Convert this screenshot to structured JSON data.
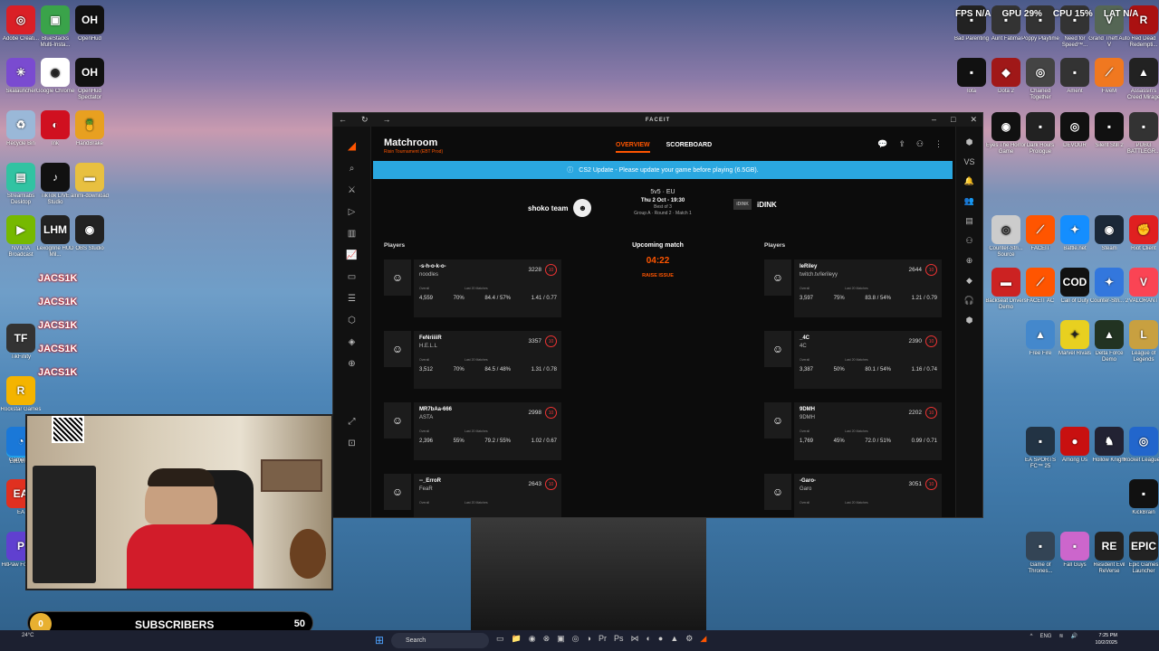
{
  "desktop_left": [
    {
      "label": "Adobe Creati...",
      "icon": "adobe-cc-icon",
      "color": "#da1f26",
      "glyph": "◎"
    },
    {
      "label": "BlueStacks Multi-Insta...",
      "icon": "bluestacks-icon",
      "color": "#3aa34a",
      "glyph": "▣"
    },
    {
      "label": "OpenHud",
      "icon": "openhud-icon",
      "color": "#111111",
      "glyph": "OH"
    },
    {
      "label": "Skalauncher",
      "icon": "skalauncher-icon",
      "color": "#7a4bd0",
      "glyph": "✳"
    },
    {
      "label": "Google Chrome",
      "icon": "chrome-icon",
      "color": "#ffffff",
      "glyph": "◉"
    },
    {
      "label": "OpenHud Spectator",
      "icon": "openhud-spectator-icon",
      "color": "#111111",
      "glyph": "OH"
    },
    {
      "label": "Recycle Bin",
      "icon": "recycle-bin-icon",
      "color": "#9ab8d8",
      "glyph": "♻"
    },
    {
      "label": "Ink",
      "icon": "ink-icon",
      "color": "#d01020",
      "glyph": "◐"
    },
    {
      "label": "HandBrake",
      "icon": "handbrake-icon",
      "color": "#e8a020",
      "glyph": "🍍"
    },
    {
      "label": "Streamlabs Desktop",
      "icon": "streamlabs-icon",
      "color": "#31c3a2",
      "glyph": "▤"
    },
    {
      "label": "TikTok LIVE Studio",
      "icon": "tiktok-icon",
      "color": "#111111",
      "glyph": "♪"
    },
    {
      "label": "alrimi-download",
      "icon": "folder-icon",
      "color": "#e8c040",
      "glyph": "▬"
    },
    {
      "label": "NVIDIA Broadcast",
      "icon": "nvidia-broadcast-icon",
      "color": "#76b900",
      "glyph": "▶"
    },
    {
      "label": "Lexogrine HUD Mil...",
      "icon": "lexogrine-icon",
      "color": "#222222",
      "glyph": "LHM"
    },
    {
      "label": "OBS Studio",
      "icon": "obs-icon",
      "color": "#222222",
      "glyph": "◉"
    },
    {
      "label": "TikFinity",
      "icon": "tikfinity-icon",
      "color": "#333333",
      "glyph": "TF"
    },
    {
      "label": "Rockstar Games",
      "icon": "rockstar-icon",
      "color": "#f4b400",
      "glyph": "R"
    },
    {
      "label": "LetsView",
      "icon": "letsview-icon",
      "color": "#20a0e8",
      "glyph": "◈"
    },
    {
      "label": "Gamelo...",
      "icon": "gameloop-icon",
      "color": "#1a78d8",
      "glyph": "◔"
    },
    {
      "label": "EA",
      "icon": "ea-icon",
      "color": "#e03020",
      "glyph": "EA"
    },
    {
      "label": "HitPaw FotorP...",
      "icon": "hitpaw-icon",
      "color": "#6040d0",
      "glyph": "P"
    }
  ],
  "jacsik_labels": [
    "JACS1K",
    "JACS1K",
    "JACS1K",
    "JACS1K",
    "JACS1K"
  ],
  "desktop_right": [
    {
      "label": "Bad Parenting",
      "icon": "bad-parenting-icon",
      "color": "#222222",
      "glyph": "▪"
    },
    {
      "label": "Aunt Fatima",
      "icon": "aunt-fatima-icon",
      "color": "#333333",
      "glyph": "▪"
    },
    {
      "label": "Poppy Playtime",
      "icon": "poppy-playtime-icon",
      "color": "#333333",
      "glyph": "▪"
    },
    {
      "label": "Need for Speed™...",
      "icon": "nfs-icon",
      "color": "#333333",
      "glyph": "▪"
    },
    {
      "label": "Grand Theft Auto V",
      "icon": "gta-v-icon",
      "color": "#556655",
      "glyph": "V"
    },
    {
      "label": "Red Dead Redempti...",
      "icon": "rdr-icon",
      "color": "#aa1111",
      "glyph": "R"
    },
    {
      "label": "Iota",
      "icon": "iota-icon",
      "color": "#111111",
      "glyph": "▪"
    },
    {
      "label": "Dota 2",
      "icon": "dota2-icon",
      "color": "#a01818",
      "glyph": "◆"
    },
    {
      "label": "Chained Together",
      "icon": "chained-together-icon",
      "color": "#444444",
      "glyph": "◎"
    },
    {
      "label": "Ament",
      "icon": "ament-icon",
      "color": "#333333",
      "glyph": "▪"
    },
    {
      "label": "FiveM",
      "icon": "fivem-icon",
      "color": "#f07820",
      "glyph": "⟋"
    },
    {
      "label": "Assassin's Creed Mirage",
      "icon": "ac-mirage-icon",
      "color": "#222222",
      "glyph": "▲"
    },
    {
      "label": "Eyes The Horror Game",
      "icon": "eyes-icon",
      "color": "#111111",
      "glyph": "◉"
    },
    {
      "label": "Dark Hours Prologue",
      "icon": "dark-hours-icon",
      "color": "#222222",
      "glyph": "▪"
    },
    {
      "label": "DEVOUR",
      "icon": "devour-icon",
      "color": "#111111",
      "glyph": "◎"
    },
    {
      "label": "Silent Still 2",
      "icon": "silent-still-icon",
      "color": "#111111",
      "glyph": "▪"
    },
    {
      "label": "PUBG BATTLEGR...",
      "icon": "pubg-icon",
      "color": "#333333",
      "glyph": "▪"
    },
    {
      "label": "Counter-Stri... Source",
      "icon": "css-icon",
      "color": "#cccccc",
      "glyph": "◎"
    },
    {
      "label": "FACEIT",
      "icon": "faceit-icon",
      "color": "#ff5500",
      "glyph": "⟋"
    },
    {
      "label": "Battle.net",
      "icon": "battlenet-icon",
      "color": "#148eff",
      "glyph": "✦"
    },
    {
      "label": "Steam",
      "icon": "steam-icon",
      "color": "#1b2838",
      "glyph": "◉"
    },
    {
      "label": "Riot Client",
      "icon": "riot-icon",
      "color": "#e02020",
      "glyph": "✊"
    },
    {
      "label": "Backseat Drivers Demo",
      "icon": "backseat-icon",
      "color": "#cc2222",
      "glyph": "▬"
    },
    {
      "label": "FACEIT AC",
      "icon": "faceit-ac-icon",
      "color": "#ff5500",
      "glyph": "⟋"
    },
    {
      "label": "Call of Duty",
      "icon": "cod-icon",
      "color": "#111111",
      "glyph": "COD"
    },
    {
      "label": "Counter-Stri... 2",
      "icon": "cs2-icon",
      "color": "#3377dd",
      "glyph": "✦"
    },
    {
      "label": "VALORANT",
      "icon": "valorant-icon",
      "color": "#fa4454",
      "glyph": "V"
    },
    {
      "label": "Free Fire",
      "icon": "free-fire-icon",
      "color": "#4488cc",
      "glyph": "▲"
    },
    {
      "label": "Marvel Rivals",
      "icon": "marvel-rivals-icon",
      "color": "#e8d020",
      "glyph": "✦"
    },
    {
      "label": "Delta Force Demo",
      "icon": "delta-force-icon",
      "color": "#223322",
      "glyph": "▲"
    },
    {
      "label": "League of Legends",
      "icon": "lol-icon",
      "color": "#c8a040",
      "glyph": "L"
    },
    {
      "label": "EA SPORTS FC™ 25",
      "icon": "fc25-icon",
      "color": "#223344",
      "glyph": "▪"
    },
    {
      "label": "Among Us",
      "icon": "among-us-icon",
      "color": "#c81010",
      "glyph": "●"
    },
    {
      "label": "Hollow Knight",
      "icon": "hollow-knight-icon",
      "color": "#222233",
      "glyph": "♞"
    },
    {
      "label": "Rocket League®",
      "icon": "rocket-league-icon",
      "color": "#2266cc",
      "glyph": "◎"
    },
    {
      "label": "KickBrain",
      "icon": "kickbrain-icon",
      "color": "#111111",
      "glyph": "▪"
    },
    {
      "label": "Game of Thrones...",
      "icon": "got-icon",
      "color": "#334455",
      "glyph": "▪"
    },
    {
      "label": "Fall Guys",
      "icon": "fall-guys-icon",
      "color": "#cc66cc",
      "glyph": "▪"
    },
    {
      "label": "Resident Evil ReVerse",
      "icon": "re-verse-icon",
      "color": "#222222",
      "glyph": "RE"
    },
    {
      "label": "Epic Games Launcher",
      "icon": "epic-icon",
      "color": "#222222",
      "glyph": "EPIC"
    }
  ],
  "top_stats": {
    "fps": "FPS N/A",
    "gpu": "GPU 29%",
    "cpu": "CPU 15%",
    "lat": "LAT N/A"
  },
  "window": {
    "title": "FACEIT"
  },
  "matchroom": {
    "title": "Matchroom",
    "subtitle": "Risin Tournament (EBT Prod)",
    "tabs": [
      {
        "label": "OVERVIEW",
        "active": true
      },
      {
        "label": "SCOREBOARD",
        "active": false
      }
    ],
    "banner": "CS2 Update - Please update your game before playing (6.5GB)."
  },
  "match": {
    "team_left": "shoko team",
    "team_right": "iDINK",
    "team_right_logo": "iDINK",
    "format": "5v5 · EU",
    "date": "Thu 2 Oct - 19:30",
    "best_of": "Best of 3",
    "round": "Group A · Round 2 · Match 1"
  },
  "labels": {
    "players": "Players",
    "upcoming": "Upcoming match",
    "countdown": "04:22",
    "raise_issue": "RAISE ISSUE",
    "overall": "Overall",
    "last20": "Last 20 Matches"
  },
  "players_left": [
    {
      "nick": "-s-h-o-k-o-",
      "real": "noodles",
      "elo": "3228",
      "matches": "4,559",
      "winrate": "70%",
      "adr": "84.4 / 57%",
      "kd": "1.41 / 0.77"
    },
    {
      "nick": "FeNriiiiR",
      "real": "H.E.L.L",
      "elo": "3357",
      "matches": "3,512",
      "winrate": "70%",
      "adr": "84.5 / 48%",
      "kd": "1.31 / 0.78"
    },
    {
      "nick": "MR7bAa-666",
      "real": "ASTA",
      "elo": "2998",
      "matches": "2,396",
      "winrate": "55%",
      "adr": "79.2 / 55%",
      "kd": "1.02 / 0.67"
    },
    {
      "nick": "--_ErroR",
      "real": "FeaR",
      "elo": "2643",
      "matches": "",
      "winrate": "",
      "adr": "",
      "kd": ""
    }
  ],
  "players_right": [
    {
      "nick": "leRiley",
      "real": "twitch.tv/lerileyy",
      "elo": "2644",
      "matches": "3,597",
      "winrate": "75%",
      "adr": "83.8 / 54%",
      "kd": "1.21 / 0.79"
    },
    {
      "nick": "_4C",
      "real": "4C",
      "elo": "2390",
      "matches": "3,387",
      "winrate": "50%",
      "adr": "80.1 / 54%",
      "kd": "1.16 / 0.74"
    },
    {
      "nick": "9DMH",
      "real": "9DMH",
      "elo": "2202",
      "matches": "1,769",
      "winrate": "45%",
      "adr": "72.0 / 51%",
      "kd": "0.99 / 0.71"
    },
    {
      "nick": "-Garo-",
      "real": "Garo",
      "elo": "3051",
      "matches": "",
      "winrate": "",
      "adr": "",
      "kd": ""
    }
  ],
  "subscribers": {
    "current": "0",
    "label": "SUBSCRIBERS",
    "goal": "50"
  },
  "taskbar": {
    "weather": "24°C",
    "search": "Search",
    "lang": "ENG",
    "time": "7:25 PM",
    "date": "10/2/2025"
  }
}
